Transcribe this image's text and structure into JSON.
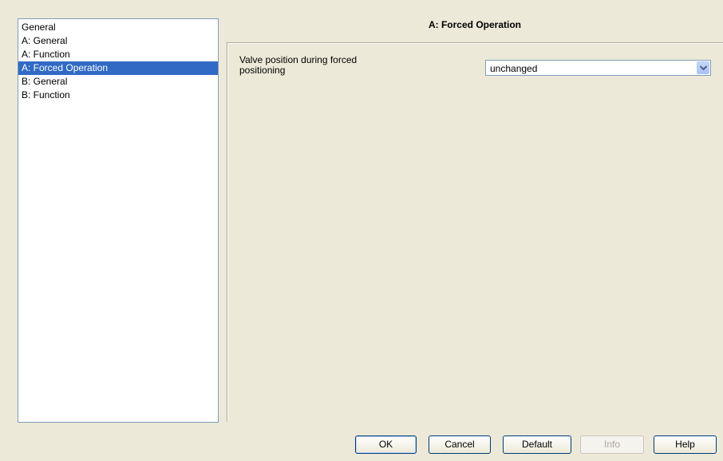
{
  "sidebar": {
    "items": [
      {
        "label": "General"
      },
      {
        "label": "A: General"
      },
      {
        "label": "A: Function"
      },
      {
        "label": "A: Forced Operation",
        "selected": true
      },
      {
        "label": "B: General"
      },
      {
        "label": "B: Function"
      }
    ]
  },
  "main": {
    "title": "A: Forced Operation",
    "parameter": {
      "label_line1": "Valve position during forced",
      "label_line2": "positioning",
      "value": "unchanged"
    }
  },
  "buttons": {
    "ok": "OK",
    "cancel": "Cancel",
    "default": "Default",
    "info": "Info",
    "help": "Help"
  },
  "colors": {
    "background": "#ece9d8",
    "selection": "#316ac5",
    "border": "#7f9db9"
  },
  "icons": {
    "dropdown": "chevron-down-icon"
  }
}
